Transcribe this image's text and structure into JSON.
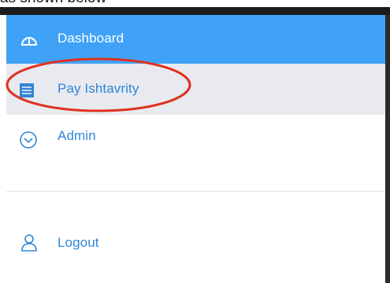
{
  "caption": "as shown below",
  "menu": {
    "items": [
      {
        "label": "Dashboard",
        "icon": "speedometer-icon",
        "active": true
      },
      {
        "label": "Pay Ishtavrity",
        "icon": "card-list-icon",
        "active": false
      },
      {
        "label": "Admin",
        "icon": "chevron-down-circle-icon",
        "active": false
      },
      {
        "label": "Logout",
        "icon": "user-icon",
        "active": false
      }
    ]
  },
  "colors": {
    "active_bg": "#3fa2f7",
    "hover_bg": "#e8eaef",
    "link": "#2f86d8",
    "annotation": "#e0301e"
  }
}
